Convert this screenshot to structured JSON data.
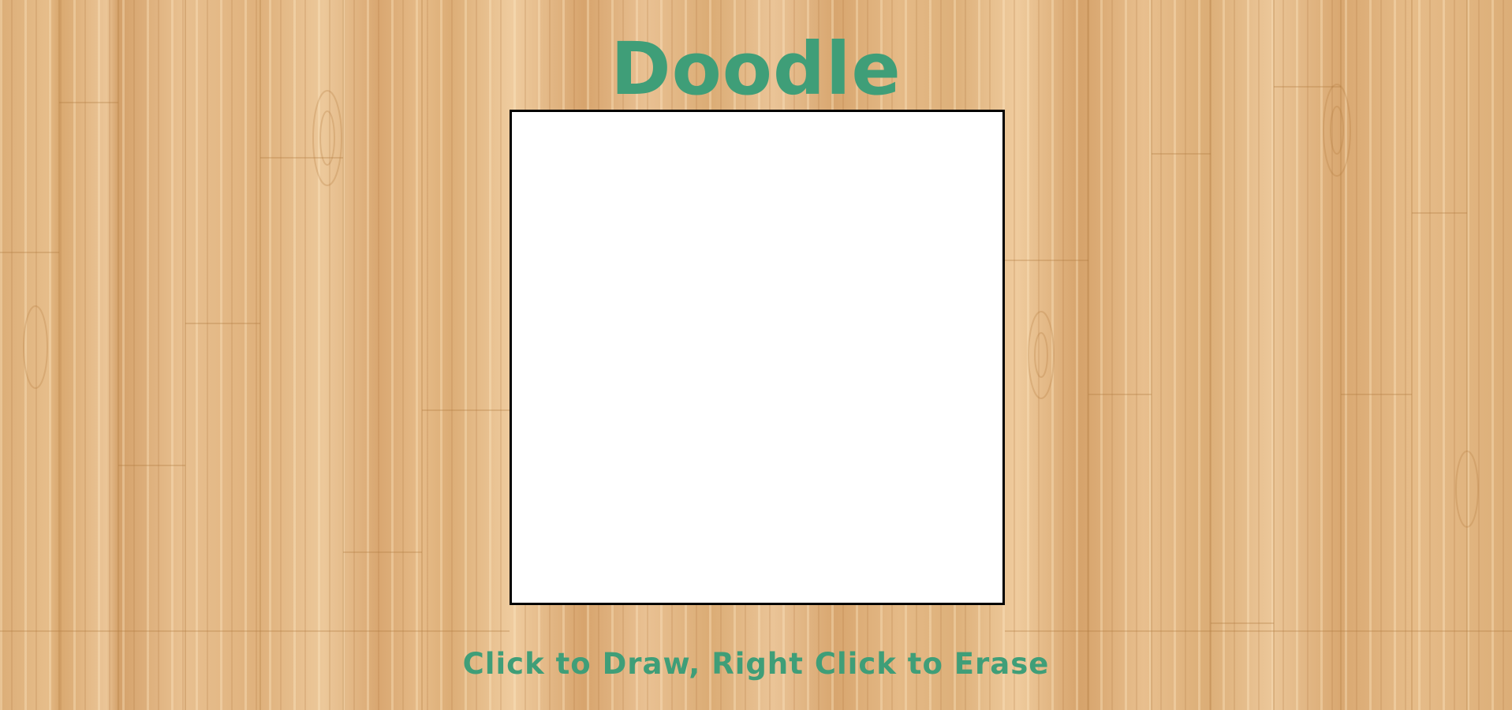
{
  "app": {
    "title": "Doodle"
  },
  "instructions": {
    "text": "Click to Draw, Right Click to Erase"
  },
  "colors": {
    "accent_text": "#3f9e78",
    "canvas_background": "#ffffff",
    "canvas_border": "#000000",
    "wood_background": "#e3b784"
  }
}
